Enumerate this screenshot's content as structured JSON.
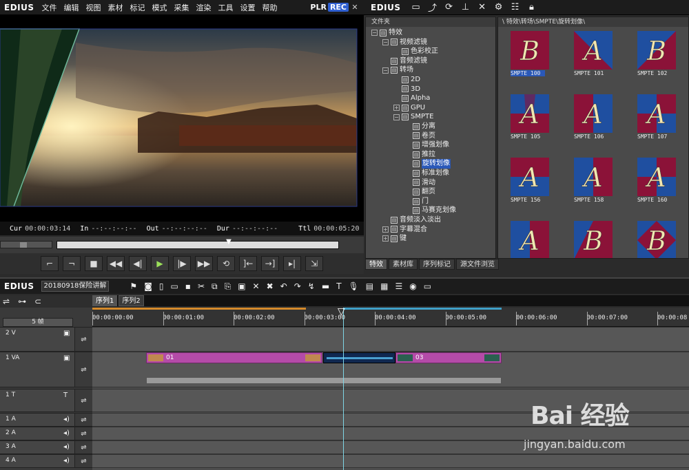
{
  "app": {
    "logo": "EDIUS",
    "menu": [
      "文件",
      "编辑",
      "视图",
      "素材",
      "标记",
      "模式",
      "采集",
      "渲染",
      "工具",
      "设置",
      "帮助"
    ],
    "plr": "PLR",
    "rec": "REC"
  },
  "player": {
    "timecodes": [
      {
        "label": "Cur",
        "value": "00:00:03:14"
      },
      {
        "label": "In",
        "value": "--:--:--:--"
      },
      {
        "label": "Out",
        "value": "--:--:--:--"
      },
      {
        "label": "Dur",
        "value": "--:--:--:--"
      },
      {
        "label": "Ttl",
        "value": "00:00:05:20"
      }
    ],
    "playhead_fraction": 0.61
  },
  "bin": {
    "logo": "EDIUS",
    "tree_header": "文件夹",
    "path": "\\ 特效\\转场\\SMPTE\\旋转划像\\",
    "tree": [
      {
        "label": "特效",
        "depth": 0,
        "exp": "−"
      },
      {
        "label": "视频滤镜",
        "depth": 1,
        "exp": "−"
      },
      {
        "label": "色彩校正",
        "depth": 2,
        "exp": ""
      },
      {
        "label": "音频滤镜",
        "depth": 1,
        "exp": ""
      },
      {
        "label": "转场",
        "depth": 1,
        "exp": "−"
      },
      {
        "label": "2D",
        "depth": 2,
        "exp": ""
      },
      {
        "label": "3D",
        "depth": 2,
        "exp": ""
      },
      {
        "label": "Alpha",
        "depth": 2,
        "exp": ""
      },
      {
        "label": "GPU",
        "depth": 2,
        "exp": "+"
      },
      {
        "label": "SMPTE",
        "depth": 2,
        "exp": "−"
      },
      {
        "label": "分离",
        "depth": 3,
        "exp": ""
      },
      {
        "label": "卷页",
        "depth": 3,
        "exp": ""
      },
      {
        "label": "增强划像",
        "depth": 3,
        "exp": ""
      },
      {
        "label": "推拉",
        "depth": 3,
        "exp": ""
      },
      {
        "label": "旋转划像",
        "depth": 3,
        "exp": "",
        "selected": true
      },
      {
        "label": "标准划像",
        "depth": 3,
        "exp": ""
      },
      {
        "label": "滑动",
        "depth": 3,
        "exp": ""
      },
      {
        "label": "翻页",
        "depth": 3,
        "exp": ""
      },
      {
        "label": "门",
        "depth": 3,
        "exp": ""
      },
      {
        "label": "马赛克划像",
        "depth": 3,
        "exp": ""
      },
      {
        "label": "音频淡入淡出",
        "depth": 1,
        "exp": ""
      },
      {
        "label": "字幕混合",
        "depth": 1,
        "exp": "+"
      },
      {
        "label": "键",
        "depth": 1,
        "exp": "+"
      }
    ],
    "thumbs": [
      {
        "label": "SMPTE  100",
        "letter": "B",
        "selected": true
      },
      {
        "label": "SMPTE  101",
        "letter": "A"
      },
      {
        "label": "SMPTE  102",
        "letter": "B"
      },
      {
        "label": "SMPTE  105",
        "letter": "A"
      },
      {
        "label": "SMPTE  106",
        "letter": "A"
      },
      {
        "label": "SMPTE  107",
        "letter": "A"
      },
      {
        "label": "SMPTE  156",
        "letter": "A"
      },
      {
        "label": "SMPTE  158",
        "letter": "A"
      },
      {
        "label": "SMPTE  160",
        "letter": "A"
      },
      {
        "label": "",
        "letter": "A"
      },
      {
        "label": "",
        "letter": "B"
      },
      {
        "label": "",
        "letter": "B"
      }
    ],
    "tabs": [
      "特效",
      "素材库",
      "序列标记",
      "源文件浏览"
    ],
    "colors": {
      "red": "#8b1238",
      "blue": "#1f4fa0",
      "letter": "#f2e6b0"
    }
  },
  "timeline": {
    "logo": "EDIUS",
    "project": "20180918保险讲解",
    "zoom": "5 帧",
    "seq_tabs": [
      "序列1",
      "序列2"
    ],
    "ruler": [
      "00:00:00:00",
      "00:00:01:00",
      "00:00:02:00",
      "00:00:03:00",
      "00:00:04:00",
      "00:00:05:00",
      "00:00:06:00",
      "00:00:07:00",
      "00:00:08"
    ],
    "tracks": [
      {
        "name": "2 V"
      },
      {
        "name": "1 VA"
      },
      {
        "name": "1 T"
      },
      {
        "name": "1 A"
      },
      {
        "name": "2 A"
      },
      {
        "name": "3 A"
      },
      {
        "name": "4 A"
      }
    ],
    "clips": [
      {
        "label": "01"
      },
      {
        "label": "03"
      }
    ]
  },
  "watermark": {
    "brand": "Bai  经验",
    "url": "jingyan.baidu.com"
  }
}
